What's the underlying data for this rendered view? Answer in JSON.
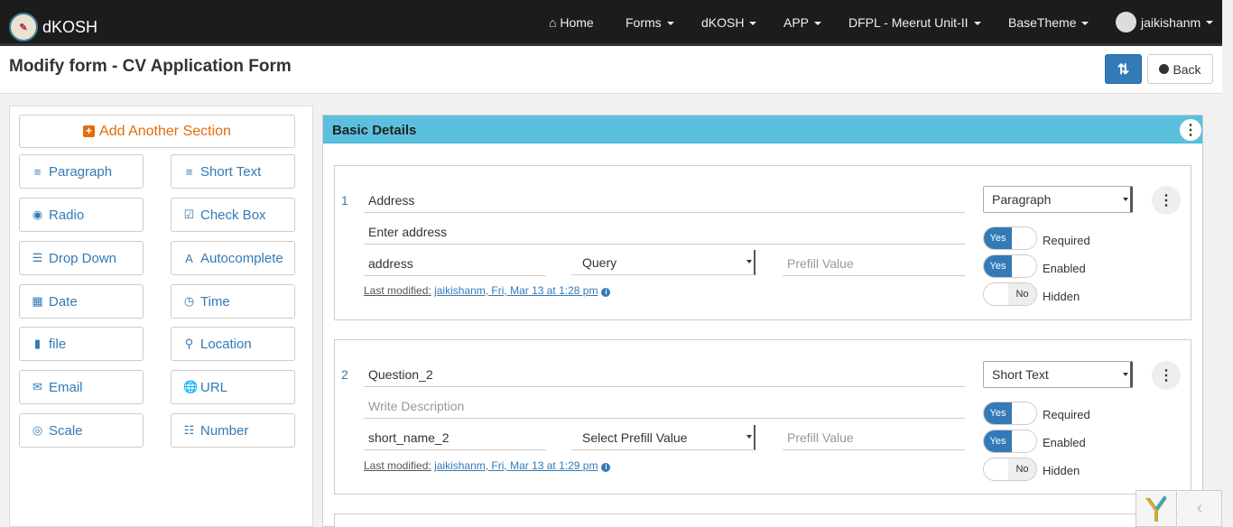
{
  "navbar": {
    "brand": "dKOSH",
    "home": "Home",
    "forms": "Forms",
    "dkosh": "dKOSH",
    "app": "APP",
    "org": "DFPL - Meerut Unit-II",
    "theme": "BaseTheme",
    "user": "jaikishanm"
  },
  "header": {
    "title": "Modify form - CV Application Form",
    "back": "Back"
  },
  "sidebar": {
    "add_section": "Add Another Section",
    "tools": [
      {
        "label": "Paragraph",
        "icon": "≡"
      },
      {
        "label": "Short Text",
        "icon": "≡"
      },
      {
        "label": "Radio",
        "icon": "◉"
      },
      {
        "label": "Check Box",
        "icon": "☑"
      },
      {
        "label": "Drop Down",
        "icon": "☰"
      },
      {
        "label": "Autocomplete",
        "icon": "A"
      },
      {
        "label": "Date",
        "icon": "▦"
      },
      {
        "label": "Time",
        "icon": "◷"
      },
      {
        "label": "file",
        "icon": "▮"
      },
      {
        "label": "Location",
        "icon": "⚲"
      },
      {
        "label": "Email",
        "icon": "✉"
      },
      {
        "label": "URL",
        "icon": "🌐"
      },
      {
        "label": "Scale",
        "icon": "◎"
      },
      {
        "label": "Number",
        "icon": "☷"
      }
    ]
  },
  "section": {
    "title": "Basic Details"
  },
  "questions": [
    {
      "num": "1",
      "title": "Address",
      "description": "Enter address",
      "short_name": "address",
      "prefill_source": "Query",
      "prefill_placeholder": "Prefill Value",
      "type": "Paragraph",
      "required": "Yes",
      "enabled": "Yes",
      "hidden": "No",
      "required_label": "Required",
      "enabled_label": "Enabled",
      "hidden_label": "Hidden",
      "lastmod_label": "Last modified:",
      "lastmod_value": "jaikishanm, Fri, Mar 13 at 1:28 pm"
    },
    {
      "num": "2",
      "title": "Question_2",
      "description": "Write Description",
      "short_name": "short_name_2",
      "prefill_source": "Select Prefill Value",
      "prefill_placeholder": "Prefill Value",
      "type": "Short Text",
      "required": "Yes",
      "enabled": "Yes",
      "hidden": "No",
      "required_label": "Required",
      "enabled_label": "Enabled",
      "hidden_label": "Hidden",
      "lastmod_label": "Last modified:",
      "lastmod_value": "jaikishanm, Fri, Mar 13 at 1:29 pm"
    }
  ],
  "colors": {
    "navbar": "#1c1c1c",
    "primary": "#337ab7",
    "section_header": "#5bc0de",
    "add_section": "#e36c0a"
  }
}
